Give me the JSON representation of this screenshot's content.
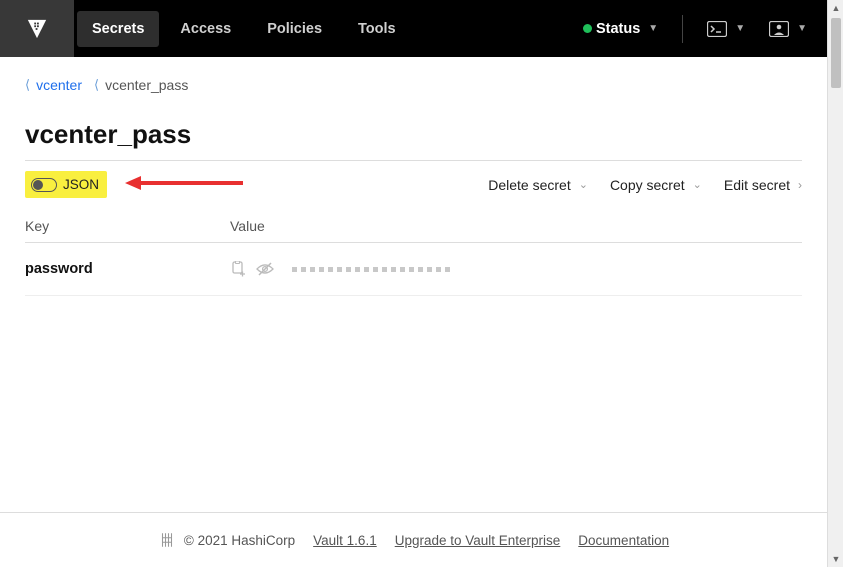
{
  "header": {
    "nav": {
      "secrets": "Secrets",
      "access": "Access",
      "policies": "Policies",
      "tools": "Tools"
    },
    "status_label": "Status"
  },
  "breadcrumb": {
    "parent": "vcenter",
    "current": "vcenter_pass"
  },
  "page": {
    "title": "vcenter_pass"
  },
  "toolbar": {
    "json_label": "JSON",
    "actions": {
      "delete": "Delete secret",
      "copy": "Copy secret",
      "edit": "Edit secret"
    }
  },
  "table": {
    "headers": {
      "key": "Key",
      "value": "Value"
    },
    "rows": [
      {
        "key": "password"
      }
    ]
  },
  "footer": {
    "copyright": "© 2021 HashiCorp",
    "version": "Vault 1.6.1",
    "upgrade": "Upgrade to Vault Enterprise",
    "docs": "Documentation"
  }
}
